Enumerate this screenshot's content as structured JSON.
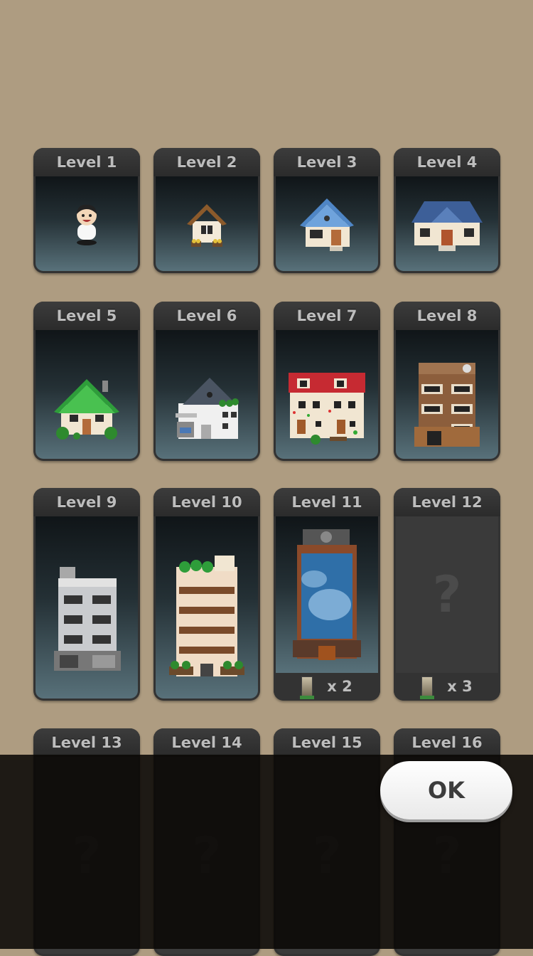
{
  "levels": [
    {
      "label": "Level 1",
      "icon": "person-icon",
      "locked": false
    },
    {
      "label": "Level 2",
      "icon": "cabin-icon",
      "locked": false
    },
    {
      "label": "Level 3",
      "icon": "blue-roof-house-icon",
      "locked": false
    },
    {
      "label": "Level 4",
      "icon": "large-house-icon",
      "locked": false
    },
    {
      "label": "Level 5",
      "icon": "green-roof-house-icon",
      "locked": false
    },
    {
      "label": "Level 6",
      "icon": "modern-house-icon",
      "locked": false
    },
    {
      "label": "Level 7",
      "icon": "townhouse-icon",
      "locked": false
    },
    {
      "label": "Level 8",
      "icon": "apartment-icon",
      "locked": false
    },
    {
      "label": "Level 9",
      "icon": "office-building-icon",
      "locked": false
    },
    {
      "label": "Level 10",
      "icon": "condo-building-icon",
      "locked": false
    },
    {
      "label": "Level 11",
      "icon": "glass-tower-icon",
      "locked": false,
      "requirement": "x 2"
    },
    {
      "label": "Level 12",
      "icon": "question-mark-icon",
      "locked": true,
      "locked_text": "?",
      "requirement": "x 3"
    },
    {
      "label": "Level 13",
      "icon": "question-mark-icon",
      "locked": true,
      "locked_text": "?"
    },
    {
      "label": "Level 14",
      "icon": "question-mark-icon",
      "locked": true,
      "locked_text": "?"
    },
    {
      "label": "Level 15",
      "icon": "question-mark-icon",
      "locked": true,
      "locked_text": "?"
    },
    {
      "label": "Level 16",
      "icon": "question-mark-icon",
      "locked": true,
      "locked_text": "?"
    }
  ],
  "ok_button": {
    "label": "OK"
  },
  "colors": {
    "background": "#ae9c81",
    "card": "#333333",
    "header_text": "#bdbdbd",
    "overlay": "#0a0806"
  }
}
